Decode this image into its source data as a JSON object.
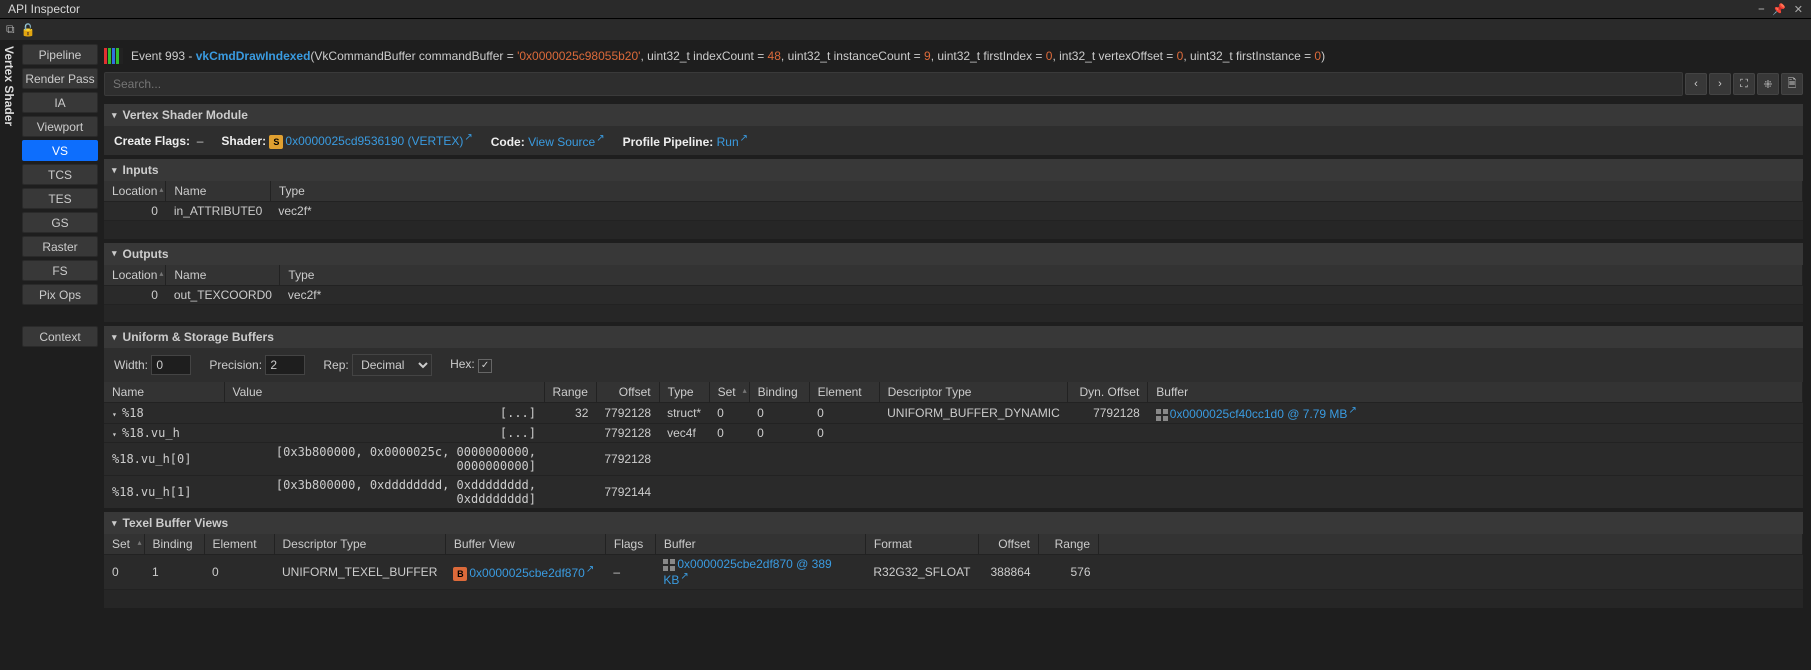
{
  "window": {
    "title": "API Inspector"
  },
  "sidebar": {
    "tabs": [
      "Pipeline",
      "Render Pass",
      "IA",
      "Viewport",
      "VS",
      "TCS",
      "TES",
      "GS",
      "Raster",
      "FS",
      "Pix Ops",
      "Context"
    ],
    "active": "VS",
    "vertical_label": "Vertex Shader"
  },
  "event": {
    "prefix": "Event 993 -",
    "call": "vkCmdDrawIndexed",
    "params": [
      {
        "k": "VkCommandBuffer commandBuffer",
        "v": "'0x0000025c98055b20'"
      },
      {
        "k": "uint32_t indexCount",
        "v": "48"
      },
      {
        "k": "uint32_t instanceCount",
        "v": "9"
      },
      {
        "k": "uint32_t firstIndex",
        "v": "0"
      },
      {
        "k": "int32_t vertexOffset",
        "v": "0"
      },
      {
        "k": "uint32_t firstInstance",
        "v": "0"
      }
    ]
  },
  "search": {
    "placeholder": "Search..."
  },
  "module": {
    "header": "Vertex Shader Module",
    "create_flags_label": "Create Flags:",
    "create_flags_value": "–",
    "shader_label": "Shader:",
    "shader_link": "0x0000025cd9536190 (VERTEX)",
    "code_label": "Code:",
    "code_link": "View Source",
    "profile_label": "Profile Pipeline:",
    "profile_link": "Run"
  },
  "inputs": {
    "header": "Inputs",
    "cols": [
      "Location",
      "Name",
      "Type"
    ],
    "rows": [
      {
        "location": "0",
        "name": "in_ATTRIBUTE0",
        "type": "vec2f*"
      }
    ]
  },
  "outputs": {
    "header": "Outputs",
    "cols": [
      "Location",
      "Name",
      "Type"
    ],
    "rows": [
      {
        "location": "0",
        "name": "out_TEXCOORD0",
        "type": "vec2f*"
      }
    ]
  },
  "buffers": {
    "header": "Uniform & Storage Buffers",
    "ctrl": {
      "width": "Width:",
      "width_v": "0",
      "precision": "Precision:",
      "precision_v": "2",
      "rep": "Rep:",
      "rep_v": "Decimal",
      "hex": "Hex:"
    },
    "cols": [
      "Name",
      "Value",
      "Range",
      "Offset",
      "Type",
      "Set",
      "Binding",
      "Element",
      "Descriptor Type",
      "Dyn. Offset",
      "Buffer"
    ],
    "rows": [
      {
        "indent": 0,
        "name": "%18",
        "value": "[...]",
        "range": "32",
        "offset": "7792128",
        "type": "struct*",
        "set": "0",
        "binding": "0",
        "element": "0",
        "desc": "UNIFORM_BUFFER_DYNAMIC",
        "dyn": "7792128",
        "buffer": "0x0000025cf40cc1d0 @ 7.79 MB"
      },
      {
        "indent": 1,
        "name": "%18.vu_h",
        "value": "[...]",
        "range": "",
        "offset": "7792128",
        "type": "vec4f",
        "set": "0",
        "binding": "0",
        "element": "0",
        "desc": "",
        "dyn": "",
        "buffer": ""
      },
      {
        "indent": 2,
        "name": "%18.vu_h[0]",
        "value": "[0x3b800000, 0x0000025c, 0000000000, 0000000000]",
        "range": "",
        "offset": "7792128",
        "type": "",
        "set": "",
        "binding": "",
        "element": "",
        "desc": "",
        "dyn": "",
        "buffer": ""
      },
      {
        "indent": 2,
        "name": "%18.vu_h[1]",
        "value": "[0x3b800000, 0xdddddddd, 0xdddddddd, 0xdddddddd]",
        "range": "",
        "offset": "7792144",
        "type": "",
        "set": "",
        "binding": "",
        "element": "",
        "desc": "",
        "dyn": "",
        "buffer": ""
      }
    ]
  },
  "texel": {
    "header": "Texel Buffer Views",
    "cols": [
      "Set",
      "Binding",
      "Element",
      "Descriptor Type",
      "Buffer View",
      "Flags",
      "Buffer",
      "Format",
      "Offset",
      "Range"
    ],
    "rows": [
      {
        "set": "0",
        "binding": "1",
        "element": "0",
        "desc": "UNIFORM_TEXEL_BUFFER",
        "view": "0x0000025cbe2df870",
        "flags": "–",
        "buffer": "0x0000025cbe2df870 @ 389 KB",
        "format": "R32G32_SFLOAT",
        "offset": "388864",
        "range": "576"
      }
    ]
  }
}
